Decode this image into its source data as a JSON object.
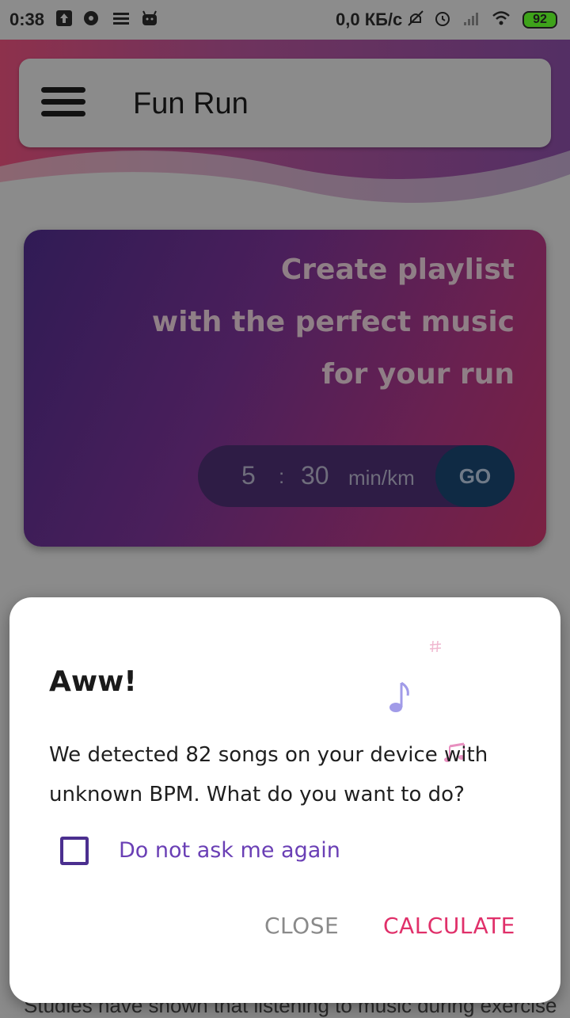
{
  "status_bar": {
    "time": "0:38",
    "network_speed": "0,0 КБ/с",
    "battery": "92",
    "icons": [
      "upload-icon",
      "record-icon",
      "list-icon",
      "android-icon",
      "mute-icon",
      "alarm-icon",
      "signal-icon",
      "wifi-icon",
      "battery-icon"
    ]
  },
  "app_bar": {
    "title": "Fun Run",
    "menu_icon": "hamburger-menu-icon"
  },
  "hero": {
    "line1": "Create playlist",
    "line2": "with the perfect music",
    "line3": "for your run",
    "pace_minutes": "5",
    "pace_separator": ":",
    "pace_seconds": "30",
    "pace_unit": "min/km",
    "go_label": "GO"
  },
  "bottom_text": "Studies have shown that listening to music during exercise",
  "dialog": {
    "title": "Aww!",
    "message": "We detected 82 songs on your device with unknown BPM. What do you want to do?",
    "checkbox_label": "Do not ask me again",
    "checkbox_checked": false,
    "close_label": "CLOSE",
    "calculate_label": "CALCULATE",
    "colors": {
      "accent": "#e0306a",
      "checkbox": "#4b2f8f",
      "checkbox_label": "#6a3fb5"
    }
  }
}
